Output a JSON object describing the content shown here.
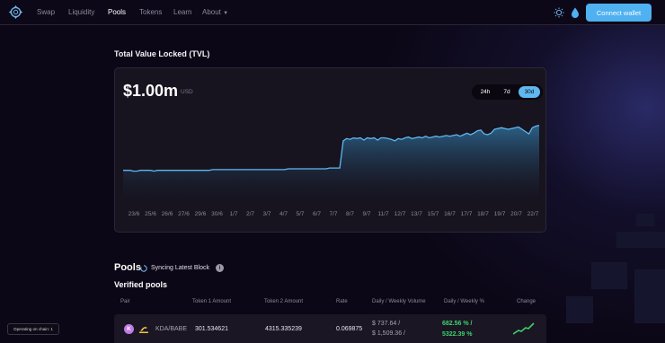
{
  "nav": {
    "items": [
      {
        "label": "Swap",
        "active": false
      },
      {
        "label": "Liquidity",
        "active": false
      },
      {
        "label": "Pools",
        "active": true
      },
      {
        "label": "Tokens",
        "active": false
      },
      {
        "label": "Learn",
        "active": false
      }
    ],
    "about_label": "About",
    "connect_label": "Connect wallet",
    "theme_icon": "sun-icon",
    "water_icon": "drop-icon"
  },
  "tvl": {
    "title": "Total Value Locked (TVL)",
    "value": "$1.00m",
    "unit": "USD",
    "ranges": [
      {
        "label": "24h",
        "active": false
      },
      {
        "label": "7d",
        "active": false
      },
      {
        "label": "30d",
        "active": true
      }
    ]
  },
  "chart_data": {
    "type": "area",
    "x_ticks": [
      "23/6",
      "25/6",
      "26/6",
      "27/6",
      "29/6",
      "30/6",
      "1/7",
      "2/7",
      "3/7",
      "4/7",
      "5/7",
      "6/7",
      "7/7",
      "8/7",
      "9/7",
      "11/7",
      "12/7",
      "13/7",
      "15/7",
      "16/7",
      "17/7",
      "18/7",
      "19/7",
      "20/7",
      "22/7"
    ],
    "values": [
      0.42,
      0.42,
      0.42,
      0.41,
      0.41,
      0.42,
      0.42,
      0.42,
      0.42,
      0.41,
      0.42,
      0.42,
      0.42,
      0.42,
      0.42,
      0.42,
      0.42,
      0.42,
      0.42,
      0.42,
      0.42,
      0.42,
      0.42,
      0.42,
      0.42,
      0.42,
      0.43,
      0.43,
      0.43,
      0.43,
      0.43,
      0.43,
      0.43,
      0.43,
      0.43,
      0.43,
      0.43,
      0.43,
      0.43,
      0.43,
      0.43,
      0.43,
      0.43,
      0.43,
      0.43,
      0.43,
      0.43,
      0.43,
      0.44,
      0.44,
      0.44,
      0.44,
      0.44,
      0.44,
      0.44,
      0.44,
      0.44,
      0.44,
      0.44,
      0.44,
      0.45,
      0.45,
      0.45,
      0.45,
      0.8,
      0.83,
      0.82,
      0.84,
      0.83,
      0.84,
      0.81,
      0.84,
      0.83,
      0.84,
      0.81,
      0.84,
      0.84,
      0.83,
      0.82,
      0.8,
      0.83,
      0.82,
      0.84,
      0.85,
      0.83,
      0.84,
      0.85,
      0.84,
      0.86,
      0.84,
      0.85,
      0.86,
      0.85,
      0.86,
      0.87,
      0.86,
      0.87,
      0.88,
      0.86,
      0.88,
      0.9,
      0.88,
      0.9,
      0.93,
      0.94,
      0.89,
      0.88,
      0.9,
      0.95,
      0.96,
      0.97,
      0.96,
      0.95,
      0.96,
      0.97,
      0.98,
      0.95,
      0.92,
      0.89,
      0.97,
      0.99,
      1.0
    ],
    "color": "#5fb8f0",
    "grid": false
  },
  "pools": {
    "title": "Pools",
    "sync_label": "Syncing Latest Block",
    "verified_title": "Verified pools",
    "columns": [
      "Pair",
      "Token 1 Amount",
      "Token 2 Amount",
      "Rate",
      "Daily / Weekly Volume",
      "Daily / Weekly %",
      "Change"
    ],
    "rows": [
      {
        "pair": "KDA/BABE",
        "token1": "301.534621",
        "token2": "4315.335239",
        "rate": "0.069875",
        "daily_volume": "$ 737.64 /",
        "weekly_volume": "$ 1,509.36 /",
        "daily_pct": "682.56 % /",
        "weekly_pct": "5322.39 %",
        "kda_badge": "K",
        "change_trend": "up"
      }
    ]
  },
  "status": {
    "label": "Operating on chain: 1"
  },
  "colors": {
    "accent": "#4fb1f0",
    "positive": "#3fd16a",
    "background": "#0c0716"
  }
}
